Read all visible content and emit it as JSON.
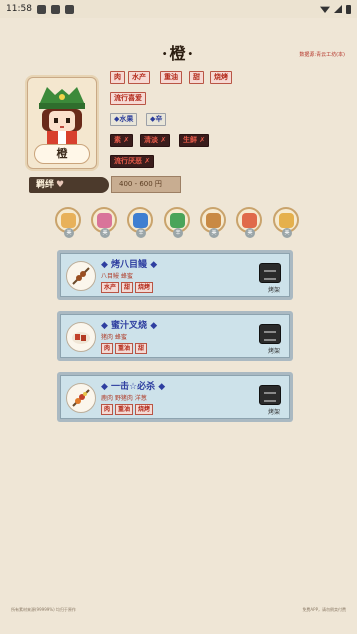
{
  "status_bar": {
    "time": "11:58"
  },
  "title": "·橙·",
  "source": "数据源:青云工坊(本)",
  "avatar": {
    "name": "橙"
  },
  "tags": {
    "row1": [
      "肉",
      "水产",
      "重油",
      "甜",
      "烧烤"
    ],
    "row2": [
      "流行喜爱"
    ],
    "row3": [
      "◆水果",
      "◆辛"
    ],
    "row4": [
      "素 ✗",
      "清淡 ✗",
      "生鲜 ✗"
    ],
    "row5": [
      "流行厌恶 ✗"
    ]
  },
  "bond": {
    "label": "羁绊",
    "price": "400 - 600 円"
  },
  "ingredients": [
    {
      "name": "pudding-icon",
      "badge": "美",
      "color": "#e8b15a"
    },
    {
      "name": "cake-icon",
      "badge": "美",
      "color": "#d9749a"
    },
    {
      "name": "drink-icon",
      "badge": "辛",
      "color": "#3f7fd1"
    },
    {
      "name": "matcha-icon",
      "badge": "辛",
      "color": "#4aa45a"
    },
    {
      "name": "donut-icon",
      "badge": "美",
      "color": "#c98a44"
    },
    {
      "name": "parfait-icon",
      "badge": "美",
      "color": "#e06a4a"
    },
    {
      "name": "pie-icon",
      "badge": "美",
      "color": "#e5b04c"
    }
  ],
  "recipes": [
    {
      "name": "◆ 烤八目鳗 ◆",
      "ingredients": "八目鳗 蜂蜜",
      "tags": [
        "水产",
        "甜",
        "烧烤"
      ],
      "tool": "烤架"
    },
    {
      "name": "◆ 蜜汁叉烧 ◆",
      "ingredients": "猪肉 蜂蜜",
      "tags": [
        "肉",
        "重油",
        "甜"
      ],
      "tool": "烤架"
    },
    {
      "name": "◆ 一击☆必杀 ◆",
      "ingredients": "鹿肉 野猪肉 洋葱",
      "tags": [
        "肉",
        "重油",
        "烧烤"
      ],
      "tool": "烤架"
    }
  ],
  "footer": {
    "left": "所有素材来源(99999%) 均归于原作",
    "right": "免费APP，请勿倒卖付费"
  }
}
